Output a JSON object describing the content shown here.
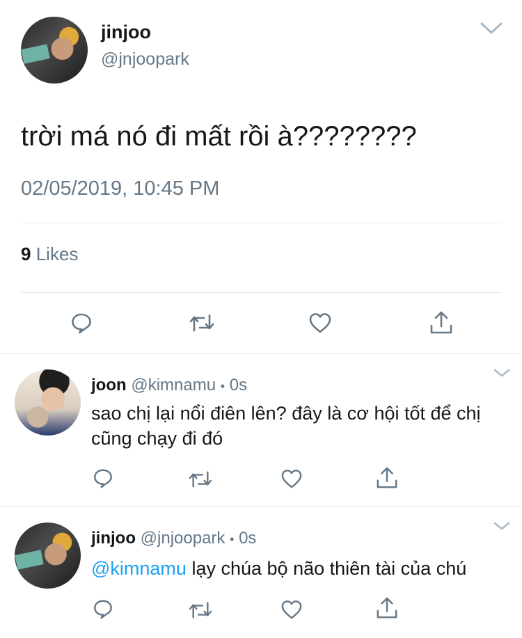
{
  "main_tweet": {
    "name": "jinjoo",
    "handle": "@jnjoopark",
    "text": "trời má nó đi mất rồi à????????",
    "timestamp": "02/05/2019, 10:45 PM",
    "likes_count": "9",
    "likes_label": "Likes"
  },
  "replies": [
    {
      "name": "joon",
      "handle": "@kimnamu",
      "dot": "•",
      "time": "0s",
      "text": "sao chị lại nổi điên lên? đây là cơ hội tốt để chị cũng chạy đi đó"
    },
    {
      "name": "jinjoo",
      "handle": "@jnjoopark",
      "dot": "•",
      "time": "0s",
      "mention": "@kimnamu",
      "text": "lạy chúa bộ não thiên tài của chú"
    }
  ],
  "icons": [
    "chevron-down-icon",
    "reply-icon",
    "retweet-icon",
    "like-icon",
    "share-icon"
  ],
  "colors": {
    "text": "#14171a",
    "muted": "#657786",
    "link": "#1da1f2",
    "icon": "#657786",
    "divider": "#e1e8ed"
  }
}
